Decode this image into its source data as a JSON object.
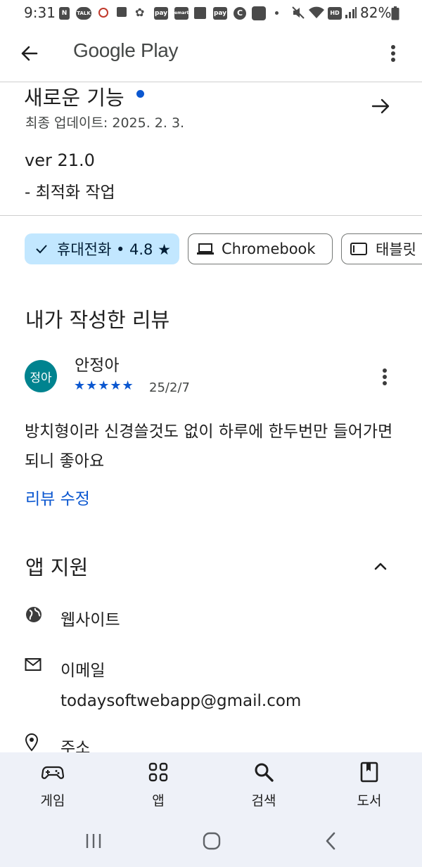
{
  "status_bar": {
    "time": "9:31",
    "battery": "82%",
    "icons": [
      "N",
      "TALK",
      "pay",
      "emart",
      "pay",
      "C",
      "HD"
    ]
  },
  "app_bar": {
    "title": "Google Play",
    "back_icon": "back-arrow-icon",
    "menu_icon": "more-vert-icon"
  },
  "whats_new": {
    "title": "새로운 기능",
    "updated": "최종 업데이트: 2025. 2. 3.",
    "version": "ver 21.0",
    "note": "- 최적화 작업"
  },
  "device_chips": [
    {
      "label": "휴대전화 • 4.8 ★",
      "selected": true,
      "icon": "check-icon"
    },
    {
      "label": "Chromebook",
      "selected": false,
      "icon": "laptop-icon"
    },
    {
      "label": "태블릿",
      "selected": false,
      "icon": "tablet-icon"
    }
  ],
  "my_review": {
    "heading": "내가 작성한 리뷰",
    "avatar_text": "정아",
    "avatar_color": "#00838f",
    "reviewer": "안정아",
    "stars": "★★★★★",
    "rating": 5,
    "date": "25/2/7",
    "text": "방치형이라 신경쓸것도 없이 하루에 한두번만 들어가면 되니 좋아요",
    "edit_label": "리뷰 수정"
  },
  "app_support": {
    "heading": "앱 지원",
    "website_label": "웹사이트",
    "email_label": "이메일",
    "email_value": "todaysoftwebapp@gmail.com",
    "address_label": "주소"
  },
  "bottom_nav": {
    "items": [
      {
        "label": "게임",
        "icon": "gamepad-icon"
      },
      {
        "label": "앱",
        "icon": "apps-grid-icon"
      },
      {
        "label": "검색",
        "icon": "search-icon"
      },
      {
        "label": "도서",
        "icon": "book-icon"
      }
    ]
  },
  "colors": {
    "accent": "#0b57d0",
    "chip_selected": "#c2e7ff",
    "nav_background": "#eef1f8"
  }
}
